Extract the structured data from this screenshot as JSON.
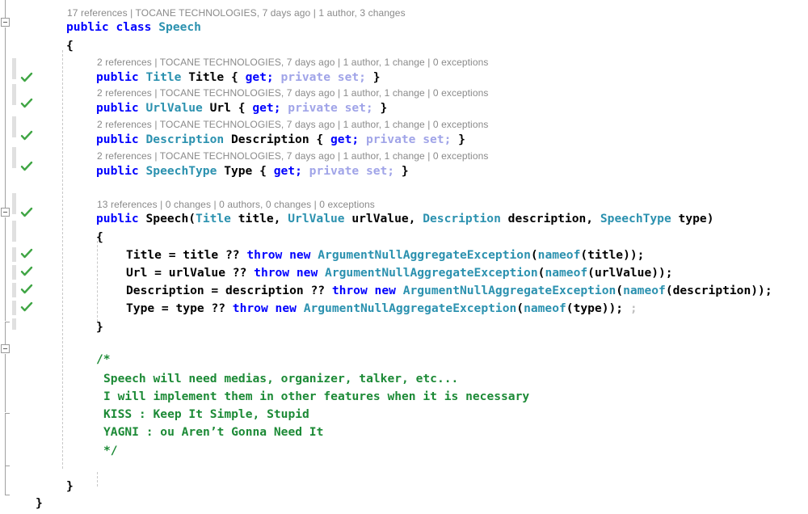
{
  "editor": {
    "language": "csharp",
    "theme": "visual-studio-light",
    "colors": {
      "keyword": "#0000FF",
      "type": "#2B91AF",
      "modifier": "#A0A4E8",
      "comment": "#1C8A36",
      "plain": "#000000",
      "codelens": "#8A8A8A",
      "faded": "#C0C0C0",
      "check": "#3FA544",
      "change_bar": "#E0E0E0",
      "indent_guide": "#C8C8C8",
      "background": "#FFFFFF"
    }
  },
  "codelens": {
    "class": "17 references | TOCANE TECHNOLOGIES, 7 days ago | 1 author, 3 changes",
    "title_prop": "2 references | TOCANE TECHNOLOGIES, 7 days ago | 1 author, 1 change | 0 exceptions",
    "url_prop": "2 references | TOCANE TECHNOLOGIES, 7 days ago | 1 author, 1 change | 0 exceptions",
    "description_prop": "2 references | TOCANE TECHNOLOGIES, 7 days ago | 1 author, 1 change | 0 exceptions",
    "type_prop": "2 references | TOCANE TECHNOLOGIES, 7 days ago | 1 author, 1 change | 0 exceptions",
    "constructor": "13 references | 0 changes | 0 authors, 0 changes | 0 exceptions"
  },
  "code": {
    "class_decl": {
      "kw_public": "public",
      "kw_class": "class",
      "name": "Speech"
    },
    "brace_open_class": "{",
    "brace_close_class": "}",
    "properties": [
      {
        "modifier": "public",
        "type": "Title",
        "name": "Title",
        "accessors_open": "{ ",
        "get": "get;",
        "private_set": " private set; ",
        "accessors_close": "}"
      },
      {
        "modifier": "public",
        "type": "UrlValue",
        "name": "Url",
        "accessors_open": "{ ",
        "get": "get;",
        "private_set": " private set; ",
        "accessors_close": "}"
      },
      {
        "modifier": "public",
        "type": "Description",
        "name": "Description",
        "accessors_open": "{ ",
        "get": "get;",
        "private_set": " private set; ",
        "accessors_close": "}"
      },
      {
        "modifier": "public",
        "type": "SpeechType",
        "name": "Type",
        "accessors_open": "{ ",
        "get": "get;",
        "private_set": " private set; ",
        "accessors_close": "}"
      }
    ],
    "constructor": {
      "modifier": "public",
      "name": "Speech",
      "paren_open": "(",
      "params": [
        {
          "type": "Title",
          "name": " title, "
        },
        {
          "type": "UrlValue",
          "name": " urlValue, "
        },
        {
          "type": "Description",
          "name": " description, "
        },
        {
          "type": "SpeechType",
          "name": " type"
        }
      ],
      "paren_close": ")",
      "brace_open": "{",
      "brace_close": "}",
      "body": [
        {
          "lhs": "Title = title ",
          "op": "?? ",
          "kw_throw": "throw",
          "kw_new": "new",
          "exception": "ArgumentNullAggregateException",
          "paren_open": "(",
          "nameof": "nameof",
          "arg": "(title));",
          "trailing": ""
        },
        {
          "lhs": "Url = urlValue ",
          "op": "?? ",
          "kw_throw": "throw",
          "kw_new": "new",
          "exception": "ArgumentNullAggregateException",
          "paren_open": "(",
          "nameof": "nameof",
          "arg": "(urlValue));",
          "trailing": ""
        },
        {
          "lhs": "Description = description ",
          "op": "?? ",
          "kw_throw": "throw",
          "kw_new": "new",
          "exception": "ArgumentNullAggregateException",
          "paren_open": "(",
          "nameof": "nameof",
          "arg": "(description));",
          "trailing": ""
        },
        {
          "lhs": "Type = type ",
          "op": "?? ",
          "kw_throw": "throw",
          "kw_new": "new",
          "exception": "ArgumentNullAggregateException",
          "paren_open": "(",
          "nameof": "nameof",
          "arg": "(type));",
          "trailing": " ;"
        }
      ]
    },
    "comment_block": {
      "open": "/*",
      "lines": [
        "Speech will need medias, organizer, talker, etc...",
        "I will implement them in other features when it is necessary",
        "KISS : Keep It Simple, Stupid",
        "YAGNI : ou Aren’t Gonna Need It"
      ],
      "close": "*/"
    },
    "brace_close_namespace": "}"
  },
  "gutter": {
    "check_icon": "checkmark-icon",
    "collapse_icon": "collapse-minus-icon",
    "checkmark_count": 9
  }
}
